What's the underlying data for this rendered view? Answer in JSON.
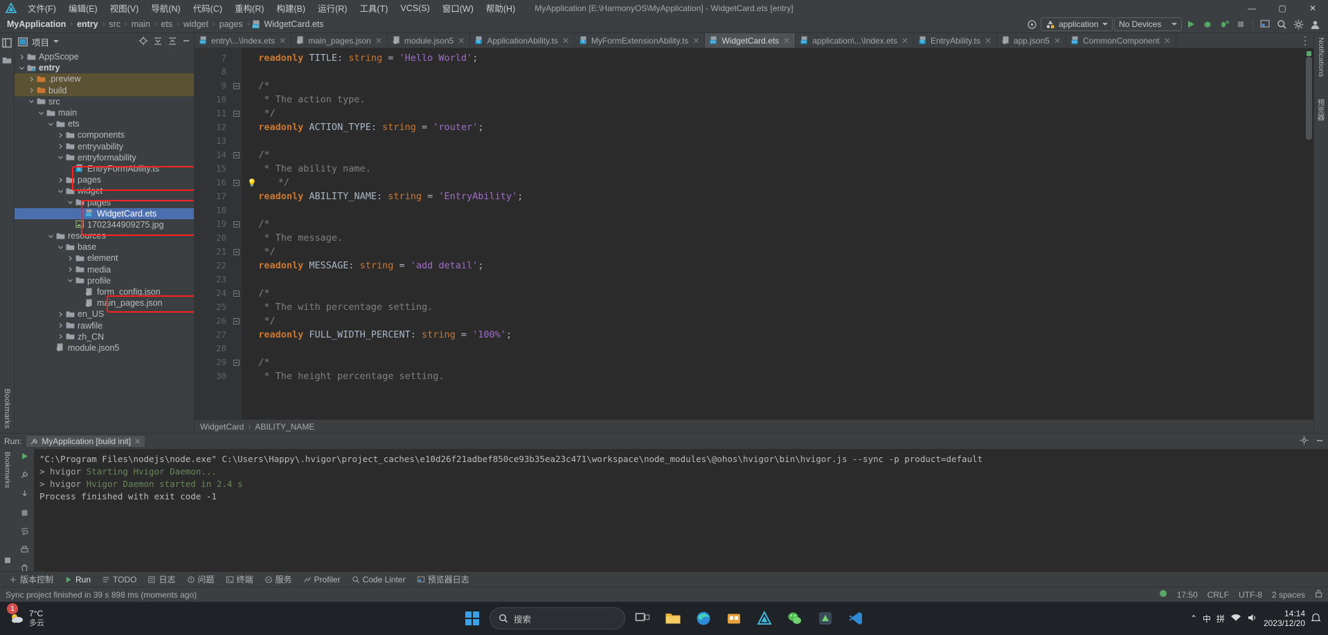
{
  "window": {
    "title": "MyApplication [E:\\HarmonyOS\\MyApplication] - WidgetCard.ets [entry]",
    "minimize": "—",
    "maximize": "▢",
    "close": "✕"
  },
  "menu": {
    "items": [
      {
        "label": "文件(F)"
      },
      {
        "label": "编辑(E)"
      },
      {
        "label": "视图(V)"
      },
      {
        "label": "导航(N)"
      },
      {
        "label": "代码(C)"
      },
      {
        "label": "重构(R)"
      },
      {
        "label": "构建(B)"
      },
      {
        "label": "运行(R)"
      },
      {
        "label": "工具(T)"
      },
      {
        "label": "VCS(S)"
      },
      {
        "label": "窗口(W)"
      },
      {
        "label": "帮助(H)"
      }
    ]
  },
  "breadcrumbs": {
    "items": [
      "MyApplication",
      "entry",
      "src",
      "main",
      "ets",
      "widget",
      "pages"
    ],
    "file": "WidgetCard.ets",
    "separator": "›"
  },
  "toolbar": {
    "target_icon": "target-icon",
    "config_label": "application",
    "device_label": "No Devices",
    "run_icon": "run-icon",
    "debug_icon": "debug-icon",
    "attach_icon": "attach-debugger-icon",
    "stop_icon": "stop-icon",
    "previewer_icon": "previewer-icon",
    "search_icon": "search-everywhere-icon",
    "settings_icon": "gear-icon",
    "account_icon": "account-icon"
  },
  "left_rail": {
    "label": "Bookmarks",
    "items": [
      "structure-icon",
      "folder-icon"
    ]
  },
  "project_panel": {
    "title": "项目",
    "dropdown_icon": "chevron-down-icon",
    "header_icons": [
      "locate-icon",
      "expand-all-icon",
      "collapse-all-icon",
      "hide-icon"
    ],
    "tree": [
      {
        "label": "AppScope",
        "indent": 1,
        "arrow": "right",
        "icon": "folder",
        "bold": false
      },
      {
        "label": "entry",
        "indent": 1,
        "arrow": "down",
        "icon": "module",
        "bold": true
      },
      {
        "label": ".preview",
        "indent": 2,
        "arrow": "right",
        "icon": "folder-orange",
        "bold": false,
        "highlight": "build"
      },
      {
        "label": "build",
        "indent": 2,
        "arrow": "right",
        "icon": "folder-orange",
        "bold": false,
        "highlight": "build"
      },
      {
        "label": "src",
        "indent": 2,
        "arrow": "down",
        "icon": "folder",
        "bold": false
      },
      {
        "label": "main",
        "indent": 3,
        "arrow": "down",
        "icon": "folder",
        "bold": false
      },
      {
        "label": "ets",
        "indent": 4,
        "arrow": "down",
        "icon": "folder",
        "bold": false
      },
      {
        "label": "components",
        "indent": 5,
        "arrow": "right",
        "icon": "folder",
        "bold": false
      },
      {
        "label": "entryvability",
        "indent": 5,
        "arrow": "right",
        "icon": "folder",
        "bold": false
      },
      {
        "label": "entryformability",
        "indent": 5,
        "arrow": "down",
        "icon": "folder",
        "bold": false
      },
      {
        "label": "EntryFormAbility.ts",
        "indent": 6,
        "arrow": "none",
        "icon": "ts-file",
        "bold": false
      },
      {
        "label": "pages",
        "indent": 5,
        "arrow": "right",
        "icon": "folder",
        "bold": false
      },
      {
        "label": "widget",
        "indent": 5,
        "arrow": "down",
        "icon": "folder",
        "bold": false
      },
      {
        "label": "pages",
        "indent": 6,
        "arrow": "down",
        "icon": "folder",
        "bold": false
      },
      {
        "label": "WidgetCard.ets",
        "indent": 7,
        "arrow": "none",
        "icon": "ets-file",
        "bold": false,
        "selected": true
      },
      {
        "label": "1702344909275.jpg",
        "indent": 6,
        "arrow": "none",
        "icon": "image-file",
        "bold": false
      },
      {
        "label": "resources",
        "indent": 4,
        "arrow": "down",
        "icon": "folder",
        "bold": false
      },
      {
        "label": "base",
        "indent": 5,
        "arrow": "down",
        "icon": "folder",
        "bold": false
      },
      {
        "label": "element",
        "indent": 6,
        "arrow": "right",
        "icon": "folder",
        "bold": false
      },
      {
        "label": "media",
        "indent": 6,
        "arrow": "right",
        "icon": "folder",
        "bold": false
      },
      {
        "label": "profile",
        "indent": 6,
        "arrow": "down",
        "icon": "folder",
        "bold": false
      },
      {
        "label": "form_config.json",
        "indent": 7,
        "arrow": "none",
        "icon": "json-file",
        "bold": false
      },
      {
        "label": "main_pages.json",
        "indent": 7,
        "arrow": "none",
        "icon": "json-file",
        "bold": false
      },
      {
        "label": "en_US",
        "indent": 5,
        "arrow": "right",
        "icon": "folder",
        "bold": false
      },
      {
        "label": "rawfile",
        "indent": 5,
        "arrow": "right",
        "icon": "folder",
        "bold": false
      },
      {
        "label": "zh_CN",
        "indent": 5,
        "arrow": "right",
        "icon": "folder",
        "bold": false
      },
      {
        "label": "module.json5",
        "indent": 4,
        "arrow": "none",
        "icon": "json-file",
        "bold": false
      }
    ],
    "annotations": [
      {
        "name": "entryformability-box"
      },
      {
        "name": "widget-pages-box"
      },
      {
        "name": "form-config-box"
      }
    ]
  },
  "editor": {
    "tabs": [
      {
        "label": "entry\\...\\Index.ets",
        "icon": "ets-file",
        "active": false
      },
      {
        "label": "main_pages.json",
        "icon": "json-file",
        "active": false
      },
      {
        "label": "module.json5",
        "icon": "json-file",
        "active": false
      },
      {
        "label": "ApplicationAbility.ts",
        "icon": "ts-file",
        "active": false
      },
      {
        "label": "MyFormExtensionAbility.ts",
        "icon": "ts-file",
        "active": false
      },
      {
        "label": "WidgetCard.ets",
        "icon": "ets-file",
        "active": true
      },
      {
        "label": "application\\...\\Index.ets",
        "icon": "ets-file",
        "active": false
      },
      {
        "label": "EntryAbility.ts",
        "icon": "ts-file",
        "active": false
      },
      {
        "label": "app.json5",
        "icon": "json-file",
        "active": false
      },
      {
        "label": "CommonComponent",
        "icon": "ets-file",
        "active": false
      }
    ],
    "close_glyph": "✕",
    "overflow_glyph": "⋮",
    "lines": [
      {
        "num": 7,
        "fold": "none",
        "tokens": [
          {
            "t": "  ",
            "c": "punc"
          },
          {
            "t": "readonly",
            "c": "kw"
          },
          {
            "t": " TITLE",
            "c": "ident"
          },
          {
            "t": ": ",
            "c": "punc"
          },
          {
            "t": "string",
            "c": "type"
          },
          {
            "t": " = ",
            "c": "eq"
          },
          {
            "t": "'Hello World'",
            "c": "str"
          },
          {
            "t": ";",
            "c": "punc"
          }
        ]
      },
      {
        "num": 8,
        "fold": "none",
        "tokens": []
      },
      {
        "num": 9,
        "fold": "start",
        "tokens": [
          {
            "t": "  /*",
            "c": "cmt"
          }
        ]
      },
      {
        "num": 10,
        "fold": "none",
        "tokens": [
          {
            "t": "   * The action type.",
            "c": "cmt"
          }
        ]
      },
      {
        "num": 11,
        "fold": "end",
        "tokens": [
          {
            "t": "   */",
            "c": "cmt"
          }
        ]
      },
      {
        "num": 12,
        "fold": "none",
        "tokens": [
          {
            "t": "  ",
            "c": "punc"
          },
          {
            "t": "readonly",
            "c": "kw"
          },
          {
            "t": " ACTION_TYPE",
            "c": "ident"
          },
          {
            "t": ": ",
            "c": "punc"
          },
          {
            "t": "string",
            "c": "type"
          },
          {
            "t": " = ",
            "c": "eq"
          },
          {
            "t": "'router'",
            "c": "str"
          },
          {
            "t": ";",
            "c": "punc"
          }
        ]
      },
      {
        "num": 13,
        "fold": "none",
        "tokens": []
      },
      {
        "num": 14,
        "fold": "start",
        "tokens": [
          {
            "t": "  /*",
            "c": "cmt"
          }
        ]
      },
      {
        "num": 15,
        "fold": "none",
        "tokens": [
          {
            "t": "   * The ability name.",
            "c": "cmt"
          }
        ]
      },
      {
        "num": 16,
        "fold": "end",
        "tokens": [
          {
            "t": "   */",
            "c": "cmt"
          }
        ],
        "bulb": true
      },
      {
        "num": 17,
        "fold": "none",
        "tokens": [
          {
            "t": "  ",
            "c": "punc"
          },
          {
            "t": "readonly",
            "c": "kw"
          },
          {
            "t": " ABILITY_NAME",
            "c": "ident"
          },
          {
            "t": ": ",
            "c": "punc"
          },
          {
            "t": "string",
            "c": "type"
          },
          {
            "t": " = ",
            "c": "eq"
          },
          {
            "t": "'EntryAbility'",
            "c": "str"
          },
          {
            "t": ";",
            "c": "punc"
          }
        ]
      },
      {
        "num": 18,
        "fold": "none",
        "tokens": []
      },
      {
        "num": 19,
        "fold": "start",
        "tokens": [
          {
            "t": "  /*",
            "c": "cmt"
          }
        ]
      },
      {
        "num": 20,
        "fold": "none",
        "tokens": [
          {
            "t": "   * The message.",
            "c": "cmt"
          }
        ]
      },
      {
        "num": 21,
        "fold": "end",
        "tokens": [
          {
            "t": "   */",
            "c": "cmt"
          }
        ]
      },
      {
        "num": 22,
        "fold": "none",
        "tokens": [
          {
            "t": "  ",
            "c": "punc"
          },
          {
            "t": "readonly",
            "c": "kw"
          },
          {
            "t": " MESSAGE",
            "c": "ident"
          },
          {
            "t": ": ",
            "c": "punc"
          },
          {
            "t": "string",
            "c": "type"
          },
          {
            "t": " = ",
            "c": "eq"
          },
          {
            "t": "'add detail'",
            "c": "str"
          },
          {
            "t": ";",
            "c": "punc"
          }
        ]
      },
      {
        "num": 23,
        "fold": "none",
        "tokens": []
      },
      {
        "num": 24,
        "fold": "start",
        "tokens": [
          {
            "t": "  /*",
            "c": "cmt"
          }
        ]
      },
      {
        "num": 25,
        "fold": "none",
        "tokens": [
          {
            "t": "   * The with percentage setting.",
            "c": "cmt"
          }
        ]
      },
      {
        "num": 26,
        "fold": "end",
        "tokens": [
          {
            "t": "   */",
            "c": "cmt"
          }
        ]
      },
      {
        "num": 27,
        "fold": "none",
        "tokens": [
          {
            "t": "  ",
            "c": "punc"
          },
          {
            "t": "readonly",
            "c": "kw"
          },
          {
            "t": " FULL_WIDTH_PERCENT",
            "c": "ident"
          },
          {
            "t": ": ",
            "c": "punc"
          },
          {
            "t": "string",
            "c": "type"
          },
          {
            "t": " = ",
            "c": "eq"
          },
          {
            "t": "'100%'",
            "c": "str"
          },
          {
            "t": ";",
            "c": "punc"
          }
        ]
      },
      {
        "num": 28,
        "fold": "none",
        "tokens": []
      },
      {
        "num": 29,
        "fold": "start",
        "tokens": [
          {
            "t": "  /*",
            "c": "cmt"
          }
        ]
      },
      {
        "num": 30,
        "fold": "none",
        "tokens": [
          {
            "t": "   * The height percentage setting.",
            "c": "cmt"
          }
        ]
      }
    ],
    "status_breadcrumb": {
      "class": "WidgetCard",
      "member": "ABILITY_NAME",
      "sep": "›"
    }
  },
  "right_rail": {
    "notifications": "Notifications",
    "previewer": "预览器"
  },
  "run_panel": {
    "label": "Run:",
    "tab": "MyApplication [build init]",
    "tab_close": "✕",
    "settings_icon": "gear-icon",
    "hide_icon": "hide-icon",
    "rail_label": "Bookmarks",
    "console": [
      {
        "text": "\"C:\\Program Files\\nodejs\\node.exe\" C:\\Users\\Happy\\.hvigor\\project_caches\\e10d26f21adbef850ce93b35ea23c471\\workspace\\node_modules\\@ohos\\hvigor\\bin\\hvigor.js --sync -p product=default",
        "color": "cn-white"
      },
      {
        "text": "",
        "color": "cn-white"
      },
      {
        "prefix": "> hvigor ",
        "text": "Starting Hvigor Daemon...",
        "color": "cn-green"
      },
      {
        "prefix": "> hvigor ",
        "text": "Hvigor Daemon started in 2.4 s",
        "color": "cn-green"
      },
      {
        "text": "",
        "color": "cn-white"
      },
      {
        "text": "",
        "color": "cn-white"
      },
      {
        "text": "Process finished with exit code -1",
        "color": "cn-white"
      }
    ]
  },
  "bottom_tools": [
    {
      "label": "版本控制",
      "icon": "vcs-icon",
      "active": false
    },
    {
      "label": "Run",
      "icon": "run-icon",
      "active": true
    },
    {
      "label": "TODO",
      "icon": "todo-icon",
      "active": false
    },
    {
      "label": "日志",
      "icon": "log-icon",
      "active": false
    },
    {
      "label": "问题",
      "icon": "problems-icon",
      "active": false
    },
    {
      "label": "终端",
      "icon": "terminal-icon",
      "active": false
    },
    {
      "label": "服务",
      "icon": "services-icon",
      "active": false
    },
    {
      "label": "Profiler",
      "icon": "profiler-icon",
      "active": false
    },
    {
      "label": "Code Linter",
      "icon": "linter-icon",
      "active": false
    },
    {
      "label": "预览器日志",
      "icon": "previewer-log-icon",
      "active": false
    }
  ],
  "statusbar": {
    "message": "Sync project finished in 39 s 898 ms (moments ago)",
    "time": "17:50",
    "line_sep": "CRLF",
    "encoding": "UTF-8",
    "indent": "2 spaces",
    "lock_icon": "lock-icon",
    "event_icon": "event-log-icon"
  },
  "taskbar": {
    "weather_temp": "7°C",
    "weather_desc": "多云",
    "search_placeholder": "搜索",
    "search_icon": "search-icon",
    "start_icon": "windows-start-icon",
    "apps": [
      {
        "name": "task-view-icon"
      },
      {
        "name": "file-explorer-icon"
      },
      {
        "name": "edge-browser-icon"
      },
      {
        "name": "store-icon"
      },
      {
        "name": "deveco-studio-icon"
      },
      {
        "name": "wechat-icon"
      },
      {
        "name": "android-studio-icon"
      },
      {
        "name": "vscode-icon"
      }
    ],
    "tray": {
      "chevron": "⌃",
      "ime_cn": "中",
      "ime_pinyin": "拼",
      "network_icon": "network-icon",
      "volume_icon": "volume-icon",
      "notification_icon": "notification-icon"
    },
    "clock_time": "14:14",
    "clock_date": "2023/12/20",
    "notif_count": "1"
  },
  "colors": {
    "accent_blue": "#4b6eaf",
    "annotation_red": "#ff2020",
    "keyword_orange": "#cc7832",
    "string_purple": "#a06dca",
    "comment_gray": "#808080",
    "console_green": "#6a8759",
    "panel_bg": "#3c3f41",
    "editor_bg": "#2b2b2b"
  }
}
